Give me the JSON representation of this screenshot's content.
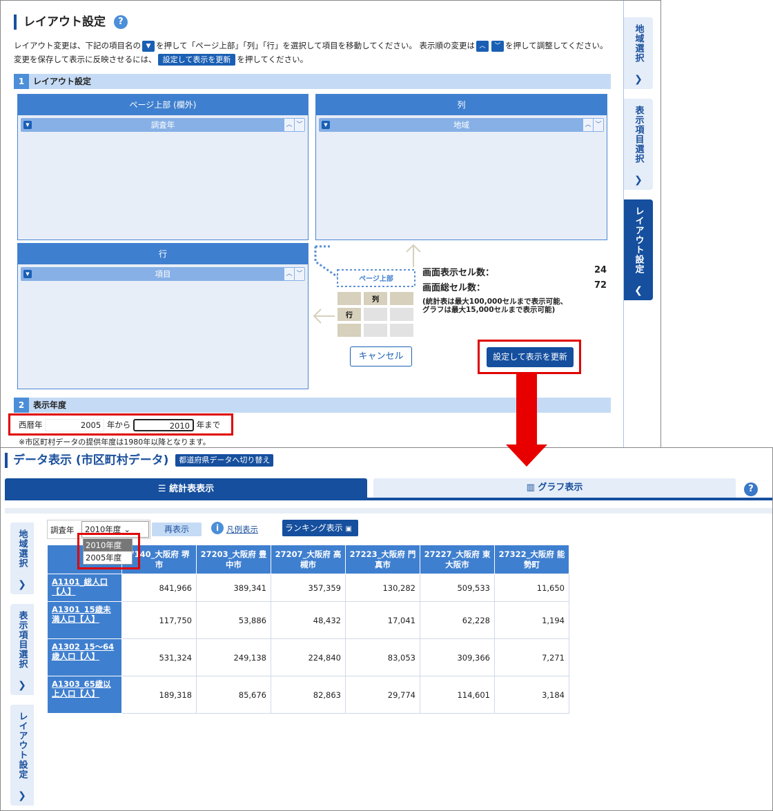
{
  "layout_panel": {
    "title": "レイアウト設定",
    "help_icon": "?",
    "desc_line1_a": "レイアウト変更は、下記の項目名の",
    "desc_line1_b": "を押して「ページ上部」「列」「行」を選択して項目を移動してください。 表示順の変更は",
    "desc_line1_c": "を押して調整してください。",
    "desc_line2_a": "変更を保存して表示に反映させるには、",
    "desc_line2_btn": "設定して表示を更新",
    "desc_line2_b": "を押してください。",
    "section1_num": "1",
    "section1_label": "レイアウト設定",
    "box_page_top": "ページ上部 (欄外)",
    "box_page_top_item": "調査年",
    "box_column": "列",
    "box_column_item": "地域",
    "box_row": "行",
    "box_row_item": "項目",
    "diagram_page_top": "ページ上部",
    "diagram_col": "列",
    "diagram_row": "行",
    "cells_display_label": "画面表示セル数：",
    "cells_display_value": "24",
    "cells_total_label": "画面総セル数：",
    "cells_total_value": "72",
    "note_line1": "(統計表は最大100,000セルまで表示可能、",
    "note_line2": "グラフは最大15,000セルまで表示可能)",
    "cancel_label": "キャンセル",
    "update_label": "設定して表示を更新",
    "section2_num": "2",
    "section2_label": "表示年度",
    "era_label": "西暦年",
    "year_from": "2005",
    "from_label": "年から",
    "year_to": "2010",
    "to_label": "年まで",
    "year_note": "※市区町村データの提供年度は1980年以降となります。"
  },
  "side_tabs": [
    "地域選択",
    "表示項目選択",
    "レイアウト設定"
  ],
  "data_panel": {
    "title": "データ表示 (市区町村データ)",
    "switch_label": "都道府県データへ切り替え",
    "tab_stats": "統計表表示",
    "tab_graph": "グラフ表示",
    "help_icon": "?",
    "year_label": "調査年",
    "year_selected": "2010年度",
    "year_options": [
      "2010年度",
      "2005年度"
    ],
    "redisplay_label": "再表示",
    "legend_label": "凡例表示",
    "ranking_label": "ランキング表示",
    "columns": [
      "27140_大阪府 堺市",
      "27203_大阪府 豊中市",
      "27207_大阪府 高槻市",
      "27223_大阪府 門真市",
      "27227_大阪府 東大阪市",
      "27322_大阪府 能勢町"
    ],
    "columns_display": [
      "7140_大阪府 堺市",
      "27203_大阪府 豊中市",
      "27207_大阪府 高槻市",
      "27223_大阪府 門真市",
      "27227_大阪府 東大阪市",
      "27322_大阪府 能勢町"
    ],
    "rows": [
      {
        "label": "A1101_総人口【人】",
        "values": [
          "841,966",
          "389,341",
          "357,359",
          "130,282",
          "509,533",
          "11,650"
        ]
      },
      {
        "label": "A1301_15歳未満人口【人】",
        "values": [
          "117,750",
          "53,886",
          "48,432",
          "17,041",
          "62,228",
          "1,194"
        ]
      },
      {
        "label": "A1302_15～64歳人口【人】",
        "values": [
          "531,324",
          "249,138",
          "224,840",
          "83,053",
          "309,366",
          "7,271"
        ]
      },
      {
        "label": "A1303_65歳以上人口【人】",
        "values": [
          "189,318",
          "85,676",
          "82,863",
          "29,774",
          "114,601",
          "3,184"
        ]
      }
    ]
  }
}
